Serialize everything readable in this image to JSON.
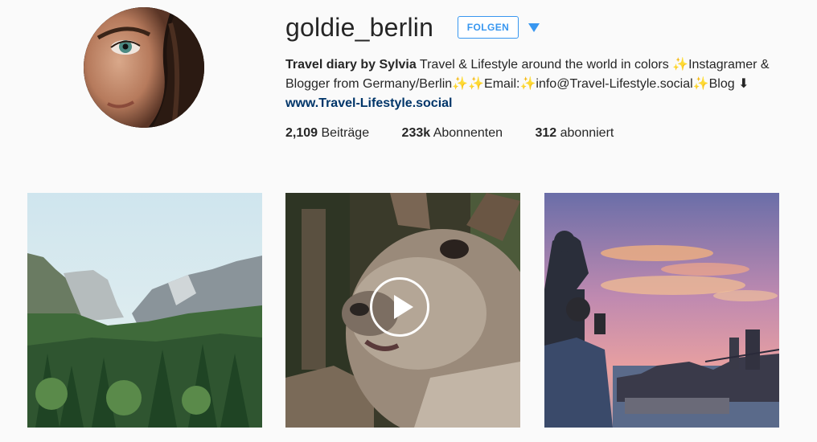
{
  "profile": {
    "username": "goldie_berlin",
    "follow_label": "FOLGEN",
    "bio_name": "Travel diary by Sylvia",
    "bio_text": " Travel & Lifestyle around the world in colors ✨Instagramer & Blogger from Germany/Berlin✨✨Email:✨info@Travel-Lifestyle.social✨Blog ⬇",
    "website": "www.Travel-Lifestyle.social"
  },
  "stats": [
    {
      "count": "2,109",
      "label": " Beiträge"
    },
    {
      "count": "233k",
      "label": " Abonnenten"
    },
    {
      "count": "312",
      "label": " abonniert"
    }
  ],
  "posts": [
    {
      "type": "image",
      "icon": "mountain-valley"
    },
    {
      "type": "video",
      "icon": "play-icon"
    },
    {
      "type": "image",
      "icon": "city-sunset"
    }
  ],
  "colors": {
    "accent": "#3897f0",
    "link": "#003569",
    "background": "#fafafa"
  }
}
